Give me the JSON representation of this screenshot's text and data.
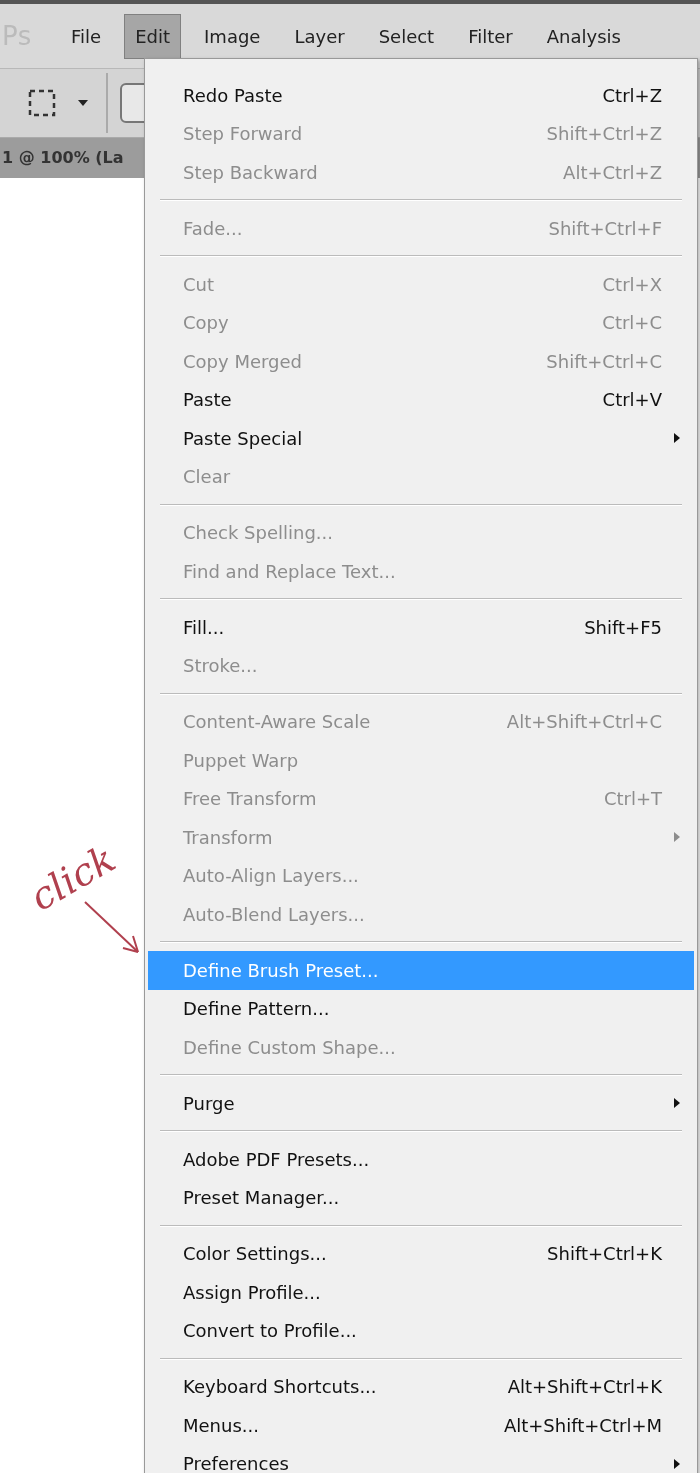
{
  "app_logo": "Ps",
  "menubar": [
    {
      "label": "File",
      "selected": false
    },
    {
      "label": "Edit",
      "selected": true
    },
    {
      "label": "Image",
      "selected": false
    },
    {
      "label": "Layer",
      "selected": false
    },
    {
      "label": "Select",
      "selected": false
    },
    {
      "label": "Filter",
      "selected": false
    },
    {
      "label": "Analysis",
      "selected": false
    }
  ],
  "document_tab": "1 @ 100% (La",
  "menu_groups": [
    [
      {
        "label": "Redo Paste",
        "shortcut": "Ctrl+Z",
        "disabled": false,
        "selected": false
      },
      {
        "label": "Step Forward",
        "shortcut": "Shift+Ctrl+Z",
        "disabled": true,
        "selected": false
      },
      {
        "label": "Step Backward",
        "shortcut": "Alt+Ctrl+Z",
        "disabled": true,
        "selected": false
      }
    ],
    [
      {
        "label": "Fade...",
        "shortcut": "Shift+Ctrl+F",
        "disabled": true,
        "selected": false
      }
    ],
    [
      {
        "label": "Cut",
        "shortcut": "Ctrl+X",
        "disabled": true,
        "selected": false
      },
      {
        "label": "Copy",
        "shortcut": "Ctrl+C",
        "disabled": true,
        "selected": false
      },
      {
        "label": "Copy Merged",
        "shortcut": "Shift+Ctrl+C",
        "disabled": true,
        "selected": false
      },
      {
        "label": "Paste",
        "shortcut": "Ctrl+V",
        "disabled": false,
        "selected": false
      },
      {
        "label": "Paste Special",
        "submenu": true,
        "disabled": false,
        "selected": false
      },
      {
        "label": "Clear",
        "disabled": true,
        "selected": false
      }
    ],
    [
      {
        "label": "Check Spelling...",
        "disabled": true,
        "selected": false
      },
      {
        "label": "Find and Replace Text...",
        "disabled": true,
        "selected": false
      }
    ],
    [
      {
        "label": "Fill...",
        "shortcut": "Shift+F5",
        "disabled": false,
        "selected": false
      },
      {
        "label": "Stroke...",
        "disabled": true,
        "selected": false
      }
    ],
    [
      {
        "label": "Content-Aware Scale",
        "shortcut": "Alt+Shift+Ctrl+C",
        "disabled": true,
        "selected": false
      },
      {
        "label": "Puppet Warp",
        "disabled": true,
        "selected": false
      },
      {
        "label": "Free Transform",
        "shortcut": "Ctrl+T",
        "disabled": true,
        "selected": false
      },
      {
        "label": "Transform",
        "submenu": true,
        "disabled": true,
        "selected": false
      },
      {
        "label": "Auto-Align Layers...",
        "disabled": true,
        "selected": false
      },
      {
        "label": "Auto-Blend Layers...",
        "disabled": true,
        "selected": false
      }
    ],
    [
      {
        "label": "Define Brush Preset...",
        "disabled": false,
        "selected": true
      },
      {
        "label": "Define Pattern...",
        "disabled": false,
        "selected": false
      },
      {
        "label": "Define Custom Shape...",
        "disabled": true,
        "selected": false
      }
    ],
    [
      {
        "label": "Purge",
        "submenu": true,
        "disabled": false,
        "selected": false
      }
    ],
    [
      {
        "label": "Adobe PDF Presets...",
        "disabled": false,
        "selected": false
      },
      {
        "label": "Preset Manager...",
        "disabled": false,
        "selected": false
      }
    ],
    [
      {
        "label": "Color Settings...",
        "shortcut": "Shift+Ctrl+K",
        "disabled": false,
        "selected": false
      },
      {
        "label": "Assign Profile...",
        "disabled": false,
        "selected": false
      },
      {
        "label": "Convert to Profile...",
        "disabled": false,
        "selected": false
      }
    ],
    [
      {
        "label": "Keyboard Shortcuts...",
        "shortcut": "Alt+Shift+Ctrl+K",
        "disabled": false,
        "selected": false
      },
      {
        "label": "Menus...",
        "shortcut": "Alt+Shift+Ctrl+M",
        "disabled": false,
        "selected": false
      },
      {
        "label": "Preferences",
        "submenu": true,
        "disabled": false,
        "selected": false
      }
    ]
  ],
  "annotation": "click"
}
